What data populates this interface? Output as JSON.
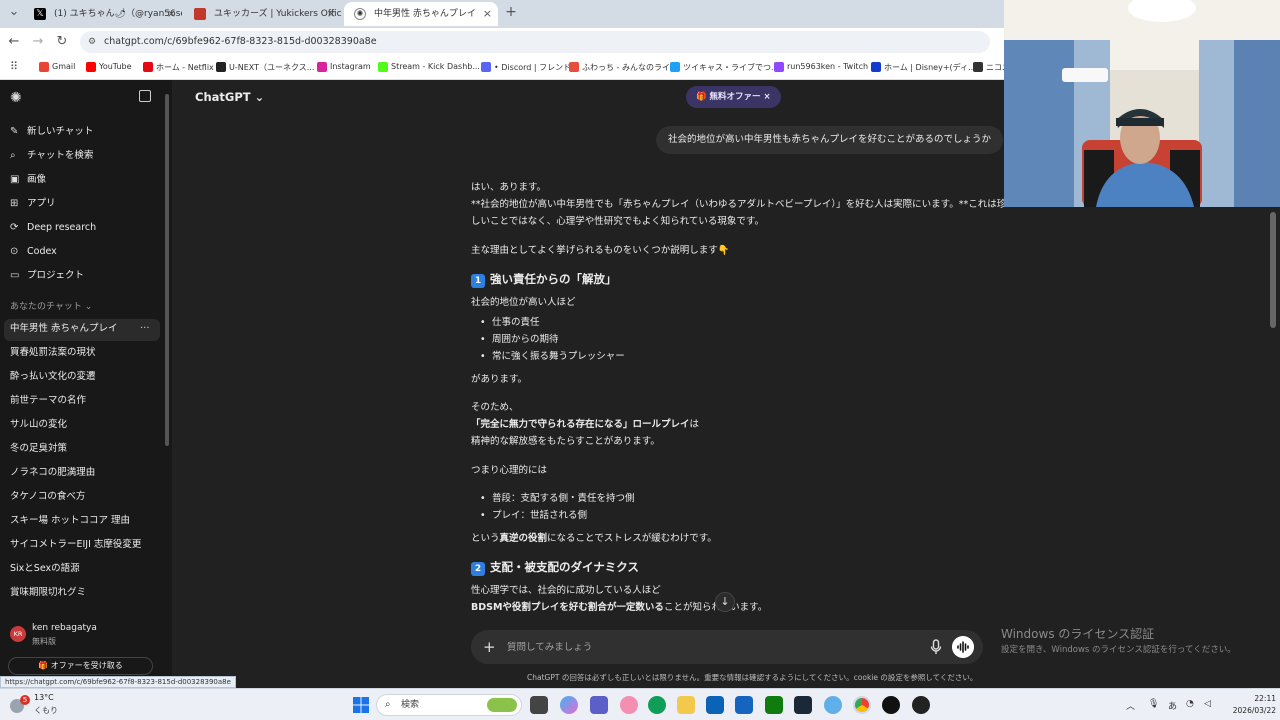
{
  "browser": {
    "tabs": [
      {
        "label": "(1) ユキちゃん🌶（@ryan56see）",
        "icon": "x-icon",
        "color": "#000000"
      },
      {
        "label": "ユキッカーズ | Yukickers Official",
        "icon": "site-icon",
        "color": "#c0392b"
      },
      {
        "label": "中年男性 赤ちゃんプレイ",
        "icon": "chatgpt-icon",
        "color": "#555555"
      }
    ],
    "new_tab": "+",
    "url": "chatgpt.com/c/69bfe962-67f8-8323-815d-d00328390a8e",
    "bookmarks": [
      {
        "label": "Gmail",
        "color": "#ea4335"
      },
      {
        "label": "YouTube",
        "color": "#ff0000"
      },
      {
        "label": "ホーム - Netflix",
        "color": "#e50914"
      },
      {
        "label": "U-NEXT（ユーネクス...",
        "color": "#222222"
      },
      {
        "label": "Instagram",
        "color": "#d6249f"
      },
      {
        "label": "Stream - Kick Dashb...",
        "color": "#53fc18"
      },
      {
        "label": "• Discord | フレンド",
        "color": "#5865f2"
      },
      {
        "label": "ふわっち - みんなのライ...",
        "color": "#e74c3c"
      },
      {
        "label": "ツイキャス・ライブでつ...",
        "color": "#1da1f2"
      },
      {
        "label": "run5963ken - Twitch",
        "color": "#9146ff"
      },
      {
        "label": "ホーム | Disney+(ディ...",
        "color": "#113ccf"
      },
      {
        "label": "ニコニ",
        "color": "#333333"
      }
    ]
  },
  "sidebar": {
    "menu": [
      {
        "label": "新しいチャット",
        "icon": "new-chat-icon",
        "glyph": "✎"
      },
      {
        "label": "チャットを検索",
        "icon": "search-icon",
        "glyph": "⌕"
      },
      {
        "label": "画像",
        "icon": "image-icon",
        "glyph": "▣"
      },
      {
        "label": "アプリ",
        "icon": "apps-icon",
        "glyph": "⊞"
      },
      {
        "label": "Deep research",
        "icon": "deep-research-icon",
        "glyph": "⟳"
      },
      {
        "label": "Codex",
        "icon": "codex-icon",
        "glyph": "⊙"
      },
      {
        "label": "プロジェクト",
        "icon": "project-icon",
        "glyph": "▭"
      }
    ],
    "section_label": "あなたのチャット ⌄",
    "chats": [
      "中年男性 赤ちゃんプレイ",
      "買春処罰法案の現状",
      "酔っ払い文化の変遷",
      "前世テーマの名作",
      "サル山の変化",
      "冬の足臭対策",
      "ノラネコの肥満理由",
      "タケノコの食べ方",
      "スキー場 ホットココア 理由",
      "サイコメトラーEIJI 志摩役変更",
      "SixとSexの語源",
      "賞味期限切れグミ"
    ],
    "user": {
      "name": "ken rebagatya",
      "plan": "無料版",
      "initials": "KR"
    },
    "offer_button": "🎁 オファーを受け取る"
  },
  "main": {
    "model": "ChatGPT ⌄",
    "offer_badge": "🎁 無料オファー ×",
    "user_message": "社会的地位が高い中年男性も赤ちゃんプレイを好むことがあるのでしょうか",
    "reply": {
      "p1": "はい、あります。",
      "p2": "**社会的地位が高い中年男性でも「赤ちゃんプレイ（いわゆるアダルトベビープレイ）」を好む人は実際にいます。**これは珍",
      "p3": "しいことではなく、心理学や性研究でもよく知られている現象です。",
      "p4": "主な理由としてよく挙げられるものをいくつか説明します👇",
      "h1_num": "1",
      "h1": "強い責任からの「解放」",
      "p5": "社会的地位が高い人ほど",
      "list1": [
        "仕事の責任",
        "周囲からの期待",
        "常に強く振る舞うプレッシャー"
      ],
      "p6": "があります。",
      "p7": "そのため、",
      "p8_bold": "「完全に無力で守られる存在になる」ロールプレイ",
      "p8_rest": "は",
      "p9": "精神的な解放感をもたらすことがあります。",
      "p10": "つまり心理的には",
      "list2": [
        "普段：支配する側・責任を持つ側",
        "プレイ：世話される側"
      ],
      "p11_pre": "という",
      "p11_bold": "真逆の役割",
      "p11_post": "になることでストレスが緩むわけです。",
      "h2_num": "2",
      "h2": "支配・被支配のダイナミクス",
      "p12": "性心理学では、社会的に成功している人ほど",
      "p13_bold": "BDSMや役割プレイを好む割合が一定数いる",
      "p13_rest": "ことが知られています。"
    },
    "composer_placeholder": "質問してみましょう",
    "disclaimer": "ChatGPT の回答は必ずしも正しいとは限りません。重要な情報は確認するようにしてください。cookie の設定を参照してください。"
  },
  "status_link": "https://chatgpt.com/c/69bfe962-67f8-8323-815d-d00328390a8e",
  "watermark": {
    "title": "Windows のライセンス認証",
    "body": "設定を開き、Windows のライセンス認証を行ってください。"
  },
  "taskbar": {
    "weather_badge": "5",
    "temp": "13°C",
    "weather": "くもり",
    "search": "検索",
    "time": "22:11",
    "date": "2026/03/22"
  }
}
